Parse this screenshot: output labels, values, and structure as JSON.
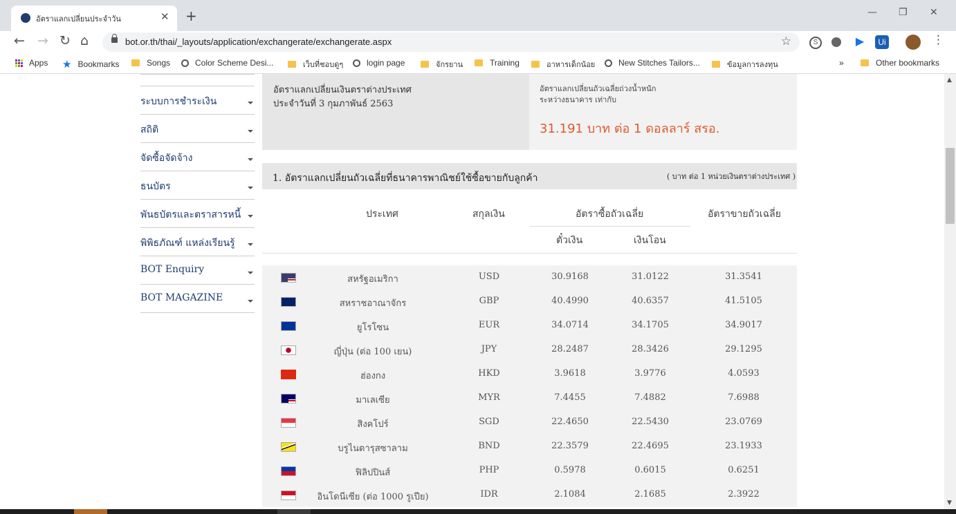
{
  "browser": {
    "tab_title": "อัตราแลกเปลี่ยนประจำวัน",
    "url": "bot.or.th/thai/_layouts/application/exchangerate/exchangerate.aspx",
    "bookmarks": [
      "Apps",
      "Bookmarks",
      "Songs",
      "Color Scheme Desi...",
      "เว็บที่ชอบดูๆ",
      "login page",
      "จักรยาน",
      "Training",
      "อาหารเด็กน้อย",
      "New Stitches Tailors...",
      "ข้อมูลการลงทุน"
    ],
    "overflow": "»",
    "other_bookmarks": "Other bookmarks"
  },
  "sidebar": {
    "items": [
      "ระบบการชำระเงิน",
      "สถิติ",
      "จัดซื้อจัดจ้าง",
      "ธนบัตร",
      "พันธบัตรและตราสารหนี้",
      "พิพิธภัณฑ์ แหล่งเรียนรู้",
      "BOT Enquiry",
      "BOT MAGAZINE"
    ]
  },
  "info": {
    "left_line1": "อัตราแลกเปลี่ยนเงินตราต่างประเทศ",
    "left_line2": "ประจำวันที่ 3 กุมภาพันธ์ 2563",
    "right_line1": "อัตราแลกเปลี่ยนถัวเฉลี่ยถ่วงน้ำหนัก",
    "right_line2": "ระหว่างธนาคาร เท่ากับ",
    "rate_text": "31.191 บาท ต่อ 1 ดอลลาร์ สรอ.",
    "rate_color": "#e05a2b"
  },
  "section": {
    "title": "1. อัตราแลกเปลี่ยนถัวเฉลี่ยที่ธนาคารพาณิชย์ใช้ซื้อขายกับลูกค้า",
    "unit": "( บาท ต่อ 1 หน่วยเงินตราต่างประเทศ )"
  },
  "table": {
    "headers": {
      "country": "ประเทศ",
      "currency": "สกุลเงิน",
      "buy": "อัตราซื้อถัวเฉลี่ย",
      "sell": "อัตราขายถัวเฉลี่ย",
      "sight": "ตั๋วเงิน",
      "tt": "เงินโอน"
    },
    "rows": [
      {
        "country": "สหรัฐอเมริกา",
        "code": "USD",
        "sight": "30.9168",
        "tt": "31.0122",
        "sell": "31.3541",
        "flag": "us"
      },
      {
        "country": "สหราชอาณาจักร",
        "code": "GBP",
        "sight": "40.4990",
        "tt": "40.6357",
        "sell": "41.5105",
        "flag": "gb"
      },
      {
        "country": "ยูโรโซน",
        "code": "EUR",
        "sight": "34.0714",
        "tt": "34.1705",
        "sell": "34.9017",
        "flag": "eu"
      },
      {
        "country": "ญี่ปุ่น (ต่อ 100 เยน)",
        "code": "JPY",
        "sight": "28.2487",
        "tt": "28.3426",
        "sell": "29.1295",
        "flag": "jp"
      },
      {
        "country": "ฮ่องกง",
        "code": "HKD",
        "sight": "3.9618",
        "tt": "3.9776",
        "sell": "4.0593",
        "flag": "hk"
      },
      {
        "country": "มาเลเซีย",
        "code": "MYR",
        "sight": "7.4455",
        "tt": "7.4882",
        "sell": "7.6988",
        "flag": "my"
      },
      {
        "country": "สิงคโปร์",
        "code": "SGD",
        "sight": "22.4650",
        "tt": "22.5430",
        "sell": "23.0769",
        "flag": "sg"
      },
      {
        "country": "บรูไนดารุสซาลาม",
        "code": "BND",
        "sight": "22.3579",
        "tt": "22.4695",
        "sell": "23.1933",
        "flag": "bn"
      },
      {
        "country": "ฟิลิปปินส์",
        "code": "PHP",
        "sight": "0.5978",
        "tt": "0.6015",
        "sell": "0.6251",
        "flag": "ph"
      },
      {
        "country": "อินโดนีเซีย (ต่อ 1000 รูเปีย)",
        "code": "IDR",
        "sight": "2.1084",
        "tt": "2.1685",
        "sell": "2.3922",
        "flag": "id"
      }
    ]
  }
}
